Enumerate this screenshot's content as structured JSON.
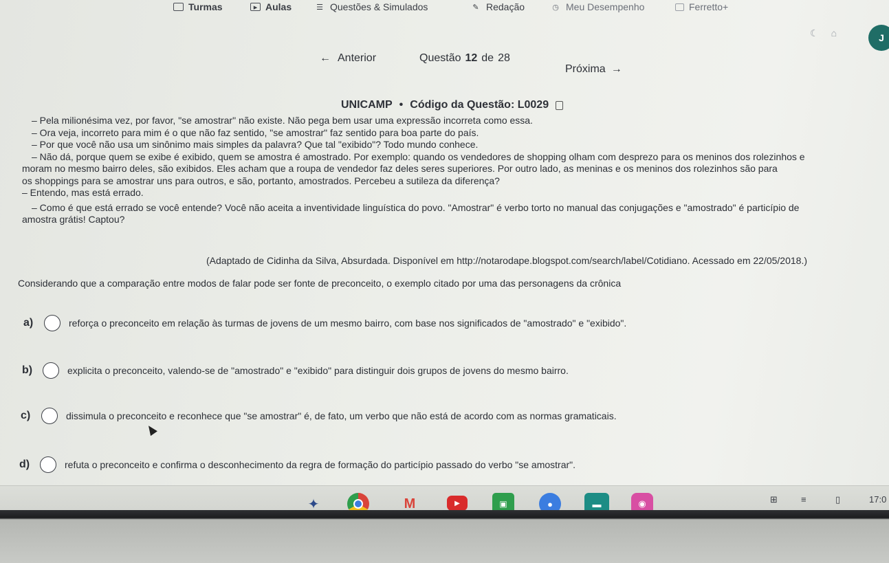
{
  "nav": {
    "items": [
      {
        "label": "Turmas",
        "icon": "checklist-icon"
      },
      {
        "label": "Aulas",
        "icon": "play-icon"
      },
      {
        "label": "Questões & Simulados",
        "icon": "list-icon"
      },
      {
        "label": "Redação",
        "icon": "pencil-icon"
      },
      {
        "label": "Meu Desempenho",
        "icon": "clock-icon"
      },
      {
        "label": "Ferretto+",
        "icon": "play-box-icon"
      }
    ],
    "avatar_initial": "J"
  },
  "pager": {
    "prev_label": "Anterior",
    "question_word": "Questão",
    "current": "12",
    "of_word": "de",
    "total": "28",
    "next_label": "Próxima"
  },
  "question": {
    "source": "UNICAMP",
    "code_label": "Código da Questão: L0029",
    "passage": [
      "– Pela milionésima vez, por favor, \"se amostrar\" não existe. Não pega bem usar uma expressão incorreta como essa.",
      "– Ora veja, incorreto para mim é o que não faz sentido, \"se amostrar\" faz sentido para boa parte do país.",
      "– Por que você não usa um sinônimo mais simples da palavra? Que tal \"exibido\"? Todo mundo conhece.",
      "– Não dá, porque quem se exibe é exibido, quem se amostra é amostrado. Por exemplo: quando os vendedores de shopping olham com desprezo para os meninos dos rolezinhos e",
      "moram no mesmo bairro deles, são exibidos. Eles acham que a roupa de vendedor faz deles seres superiores. Por outro lado, as meninas e os meninos dos rolezinhos são para",
      "os shoppings para se amostrar uns para outros, e são, portanto, amostrados. Percebeu a sutileza da diferença?",
      "– Entendo, mas está errado.",
      "– Como é que está errado se você entende? Você não aceita a inventividade linguística do povo. \"Amostrar\" é verbo torto no manual das conjugações e \"amostrado\" é particípio de",
      "amostra grátis! Captou?"
    ],
    "credit": "(Adaptado de Cidinha da Silva, Absurdada. Disponível em http://notarodape.blogspot.com/search/label/Cotidiano. Acessado em 22/05/2018.)",
    "stem": "Considerando que a comparação entre modos de falar pode ser fonte de preconceito, o exemplo citado por uma das personagens da crônica",
    "options": [
      {
        "letter": "a)",
        "text": "reforça o preconceito em relação às turmas de jovens de um mesmo bairro, com base nos significados de \"amostrado\" e \"exibido\"."
      },
      {
        "letter": "b)",
        "text": "explicita o preconceito, valendo-se de \"amostrado\" e \"exibido\" para distinguir dois grupos de jovens do mesmo bairro."
      },
      {
        "letter": "c)",
        "text": "dissimula o preconceito e reconhece que \"se amostrar\" é, de fato, um verbo que não está de acordo com as normas gramaticais."
      },
      {
        "letter": "d)",
        "text": "refuta o preconceito e confirma o desconhecimento da regra de formação do particípio passado do verbo \"se amostrar\"."
      }
    ]
  },
  "taskbar": {
    "apps": [
      "launcher-icon",
      "chrome-icon",
      "gmail-icon",
      "youtube-icon",
      "classroom-icon",
      "drawing-icon",
      "files-icon",
      "camera-icon"
    ],
    "time": "17:0"
  }
}
